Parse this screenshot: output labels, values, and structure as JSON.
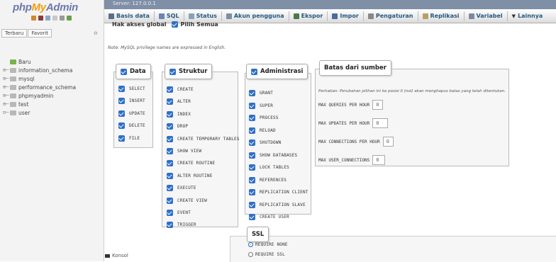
{
  "app": {
    "logo_php": "php",
    "logo_my": "My",
    "logo_admin": "Admin",
    "server_label": "Server: 127.0.0.1"
  },
  "sidebar": {
    "tabs": [
      "Terbaru",
      "Favorit"
    ],
    "collapse_symbol": "⊖",
    "databases": [
      {
        "name": "Baru",
        "prefix": "",
        "icon": "new-db-icon"
      },
      {
        "name": "information_schema",
        "prefix": "⊞─",
        "icon": "db-icon"
      },
      {
        "name": "mysql",
        "prefix": "⊞─",
        "icon": "db-icon"
      },
      {
        "name": "performance_schema",
        "prefix": "⊞─",
        "icon": "db-icon"
      },
      {
        "name": "phpmyadmin",
        "prefix": "⊞─",
        "icon": "db-icon"
      },
      {
        "name": "test",
        "prefix": "⊞─",
        "icon": "db-icon"
      },
      {
        "name": "user",
        "prefix": "⊟─",
        "icon": "db-icon"
      }
    ],
    "console_label": "Konsol"
  },
  "nav": {
    "tabs": [
      {
        "label": "Basis data",
        "icon": "database-icon",
        "color": "#5b6d8a"
      },
      {
        "label": "SQL",
        "icon": "sql-icon",
        "color": "#6a86b0"
      },
      {
        "label": "Status",
        "icon": "status-icon",
        "color": "#8aa0b8"
      },
      {
        "label": "Akun pengguna",
        "icon": "users-icon",
        "color": "#7d8ea6"
      },
      {
        "label": "Ekspor",
        "icon": "export-icon",
        "color": "#4a7a4a"
      },
      {
        "label": "Impor",
        "icon": "import-icon",
        "color": "#4a6aa0"
      },
      {
        "label": "Pengaturan",
        "icon": "wrench-icon",
        "color": "#888888"
      },
      {
        "label": "Replikasi",
        "icon": "replication-icon",
        "color": "#b8a060"
      },
      {
        "label": "Variabel",
        "icon": "variables-icon",
        "color": "#7a8aa0"
      },
      {
        "label": "Lainnya",
        "icon": "dropdown-icon",
        "color": "#333333"
      }
    ]
  },
  "global": {
    "heading": "Hak akses global",
    "check_all": "Pilih Semua",
    "note": "Note: MySQL privilege names are expressed in English."
  },
  "groups": {
    "data": {
      "title": "Data",
      "items": [
        "SELECT",
        "INSERT",
        "UPDATE",
        "DELETE",
        "FILE"
      ]
    },
    "struktur": {
      "title": "Struktur",
      "items": [
        "CREATE",
        "ALTER",
        "INDEX",
        "DROP",
        "CREATE TEMPORARY TABLES",
        "SHOW VIEW",
        "CREATE ROUTINE",
        "ALTER ROUTINE",
        "EXECUTE",
        "CREATE VIEW",
        "EVENT",
        "TRIGGER"
      ]
    },
    "admin": {
      "title": "Administrasi",
      "items": [
        "GRANT",
        "SUPER",
        "PROCESS",
        "RELOAD",
        "SHUTDOWN",
        "SHOW DATABASES",
        "LOCK TABLES",
        "REFERENCES",
        "REPLICATION CLIENT",
        "REPLICATION SLAVE",
        "CREATE USER"
      ]
    }
  },
  "resources": {
    "title": "Batas dari sumber",
    "hint": "Perhatian: Perubahan pilihan ini ke posisi 0 (nol) akan menghapus batas yang telah ditentukan.",
    "rows": [
      {
        "label": "MAX QUERIES PER HOUR",
        "value": "0"
      },
      {
        "label": "MAX UPDATES PER HOUR",
        "value": "0"
      },
      {
        "label": "MAX CONNECTIONS PER HOUR",
        "value": "0"
      },
      {
        "label": "MAX USER_CONNECTIONS",
        "value": "0"
      }
    ]
  },
  "ssl": {
    "title": "SSL",
    "options": [
      {
        "label": "REQUIRE NONE",
        "selected": true
      },
      {
        "label": "REQUIRE SSL",
        "selected": false
      }
    ]
  },
  "colors": {
    "accent": "#2f70c6",
    "nav_text": "#235a81",
    "logo_blue": "#6c78af",
    "logo_orange": "#f89c0e"
  }
}
